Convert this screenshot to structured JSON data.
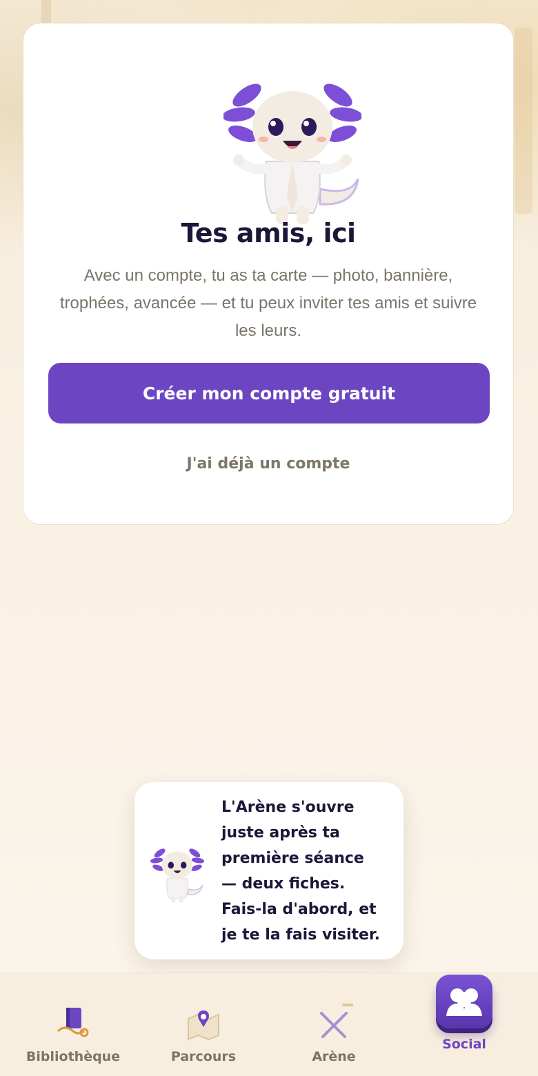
{
  "card": {
    "title": "Tes amis, ici",
    "description": "Avec un compte, tu as ta carte — photo, bannière, trophées, avancée — et tu peux inviter tes amis et suivre les leurs.",
    "primary_button": "Créer mon compte gratuit",
    "secondary_link": "J'ai déjà un compte"
  },
  "bubble": {
    "lines": [
      "L'Arène s'ouvre",
      "juste après ta",
      "première séance",
      "— deux fiches.",
      "Fais-la d'abord, et",
      "je te la fais visiter."
    ]
  },
  "nav": {
    "items": [
      {
        "label": "Bibliothèque",
        "icon": "book-stethoscope-icon"
      },
      {
        "label": "Parcours",
        "icon": "map-pin-icon"
      },
      {
        "label": "Arène",
        "icon": "crossed-swords-lock-icon"
      },
      {
        "label": "Social",
        "icon": "friends-icon",
        "active": true
      }
    ]
  },
  "colors": {
    "accent": "#6c46c2",
    "title": "#1c1638",
    "muted": "#7a746a",
    "nav_bg": "#f7eee0"
  }
}
